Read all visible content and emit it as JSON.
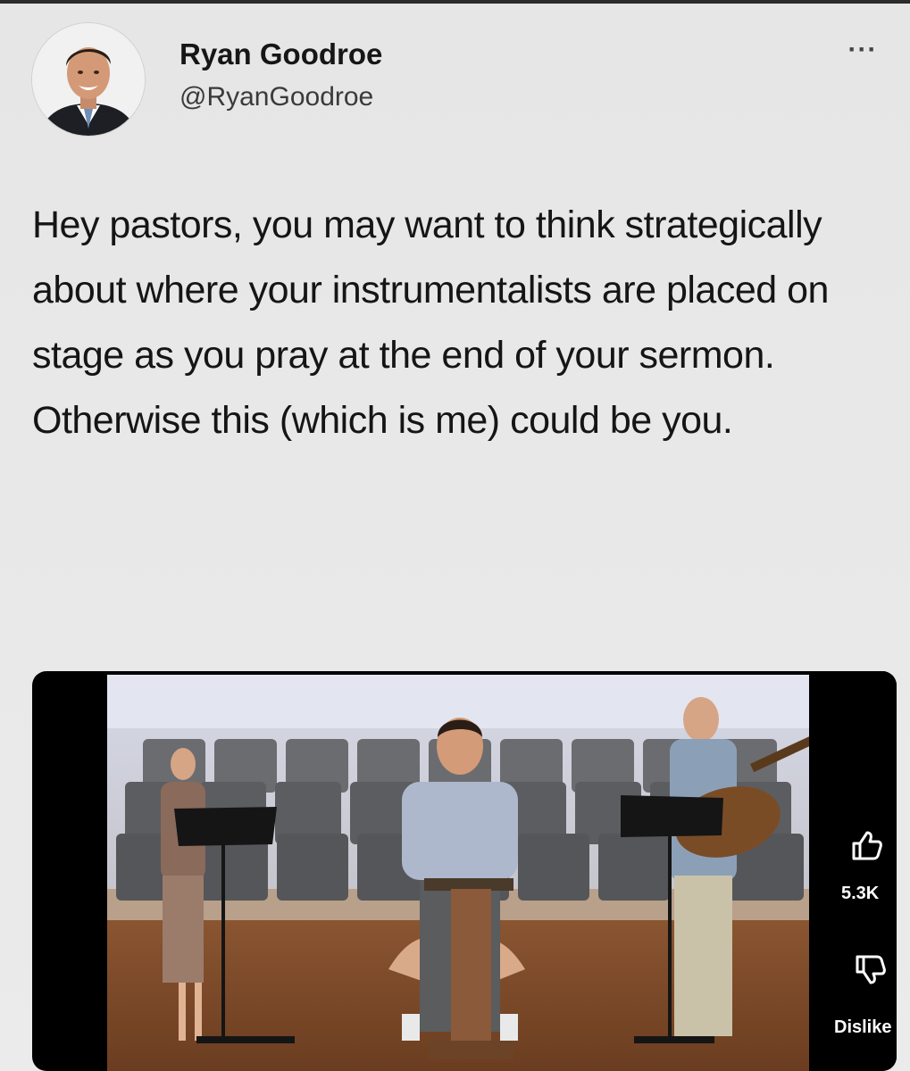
{
  "author": {
    "display_name": "Ryan Goodroe",
    "handle": "@RyanGoodroe"
  },
  "more_label": "···",
  "tweet": {
    "text": "Hey pastors, you may want to think strategically about where your instrumentalists are placed on stage as you pray at the end of your sermon. Otherwise this (which is me) could be you."
  },
  "video": {
    "like_count": "5.3K",
    "dislike_label": "Dislike"
  },
  "icons": {
    "more": "more-options-icon",
    "like": "thumbs-up-icon",
    "dislike": "thumbs-down-icon"
  },
  "colors": {
    "background": "#e9e9e9",
    "text": "#151515",
    "handle": "#3a3a3a"
  }
}
